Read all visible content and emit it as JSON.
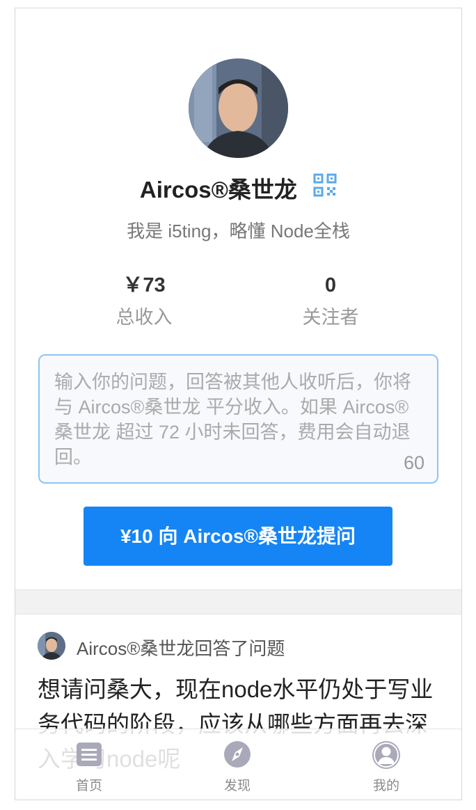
{
  "profile": {
    "name": "Aircos®桑世龙",
    "bio": "我是 i5ting，略懂 Node全栈",
    "stats": [
      {
        "value": "￥73",
        "label": "总收入"
      },
      {
        "value": "0",
        "label": "关注者"
      }
    ]
  },
  "ask": {
    "placeholder": "输入你的问题，回答被其他人收听后，你将与 Aircos®桑世龙 平分收入。如果 Aircos®桑世龙 超过 72 小时未回答，费用会自动退回。",
    "char_count": "60",
    "button_label": "¥10 向 Aircos®桑世龙提问"
  },
  "feed": {
    "items": [
      {
        "header": "Aircos®桑世龙回答了问题",
        "question": "想请问桑大，现在node水平仍处于写业务代码的阶段，应该从哪些方面再去深入学习node呢"
      }
    ]
  },
  "tabbar": {
    "items": [
      {
        "label": "首页",
        "icon": "home-list-icon"
      },
      {
        "label": "发现",
        "icon": "compass-icon"
      },
      {
        "label": "我的",
        "icon": "user-icon"
      }
    ]
  },
  "colors": {
    "accent": "#1585f5",
    "input_border": "#8ec4f3",
    "qr_icon": "#5aa9ec",
    "tab_icon": "#a9a9ba"
  }
}
